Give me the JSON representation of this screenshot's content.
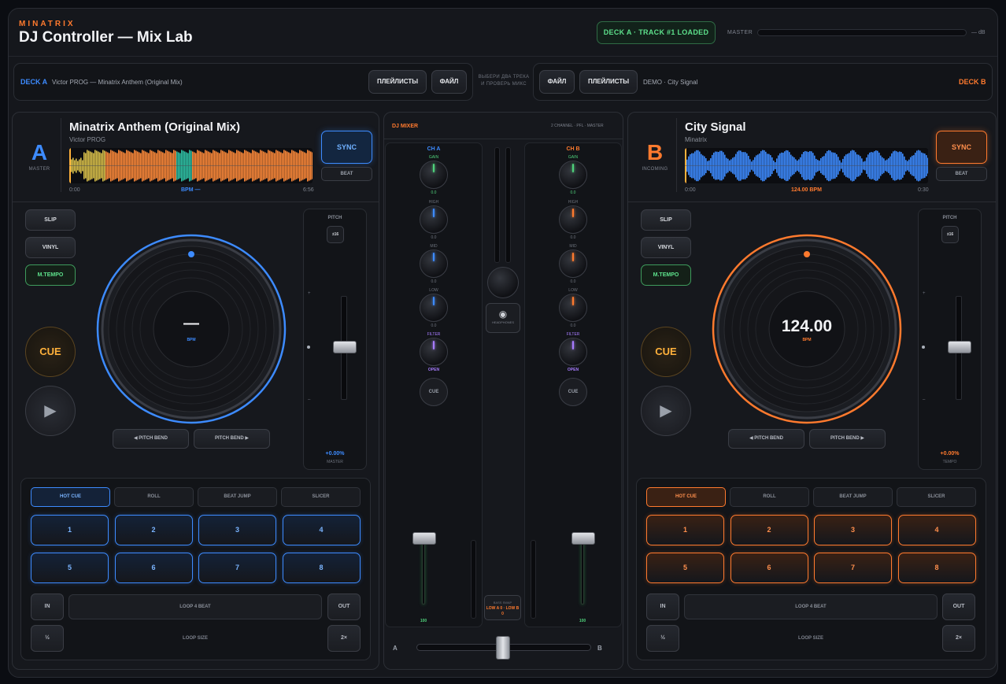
{
  "header": {
    "brand": "MINATRIX",
    "title": "DJ Controller — Mix Lab",
    "status": "DECK A · TRACK #1 LOADED",
    "master_label": "MASTER",
    "master_unit": "— dB",
    "master_level": 0
  },
  "loader": {
    "deck_a": {
      "tag": "DECK A",
      "track": "Victor PROG — Minatrix Anthem (Original Mix)",
      "playlists": "ПЛЕЙЛИСТЫ",
      "file": "ФАЙЛ"
    },
    "hint": "ВЫБЕРИ ДВА ТРЕКА И ПРОВЕРЬ МИКС",
    "deck_b": {
      "tag": "DECK B",
      "track": "DEMO · City Signal",
      "playlists": "ПЛЕЙЛИСТЫ",
      "file": "ФАЙЛ"
    }
  },
  "deck_a": {
    "letter": "A",
    "role": "MASTER",
    "title": "Minatrix Anthem (Original Mix)",
    "artist": "Victor PROG",
    "time_start": "0:00",
    "time_end": "6:56",
    "bpm_label": "BPM —",
    "sync": "SYNC",
    "beat": "BEAT",
    "buttons": {
      "slip": "SLIP",
      "vinyl": "VINYL",
      "mtempo": "M.TEMPO",
      "cue": "CUE",
      "play": "▶"
    },
    "platter": {
      "value": "—",
      "unit": "BPM"
    },
    "pitch": {
      "label": "PITCH",
      "range": "±16",
      "value": "+0.00%",
      "sub": "MASTER",
      "plus": "+",
      "minus": "–"
    },
    "pitch_bend": {
      "left": "◀ PITCH BEND",
      "right": "PITCH BEND ▶"
    },
    "pad_modes": [
      "HOT CUE",
      "ROLL",
      "BEAT JUMP",
      "SLICER"
    ],
    "pads": [
      "1",
      "2",
      "3",
      "4",
      "5",
      "6",
      "7",
      "8"
    ],
    "loop": {
      "in": "IN",
      "out": "OUT",
      "bar": "LOOP 4 BEAT",
      "half": "½",
      "double": "2×",
      "size": "LOOP SIZE"
    }
  },
  "deck_b": {
    "letter": "B",
    "role": "INCOMING",
    "title": "City Signal",
    "artist": "Minatrix",
    "time_start": "0:00",
    "time_end": "0:30",
    "bpm_label": "124.00 BPM",
    "sync": "SYNC",
    "beat": "BEAT",
    "buttons": {
      "slip": "SLIP",
      "vinyl": "VINYL",
      "mtempo": "M.TEMPO",
      "cue": "CUE",
      "play": "▶"
    },
    "platter": {
      "value": "124.00",
      "unit": "BPM"
    },
    "pitch": {
      "label": "PITCH",
      "range": "±16",
      "value": "+0.00%",
      "sub": "TEMPO",
      "plus": "+",
      "minus": "–"
    },
    "pitch_bend": {
      "left": "◀ PITCH BEND",
      "right": "PITCH BEND ▶"
    },
    "pad_modes": [
      "HOT CUE",
      "ROLL",
      "BEAT JUMP",
      "SLICER"
    ],
    "pads": [
      "1",
      "2",
      "3",
      "4",
      "5",
      "6",
      "7",
      "8"
    ],
    "loop": {
      "in": "IN",
      "out": "OUT",
      "bar": "LOOP 4 BEAT",
      "half": "½",
      "double": "2×",
      "size": "LOOP SIZE"
    }
  },
  "mixer": {
    "title": "DJ MIXER",
    "subtitle": "2 CHANNEL · PFL · MASTER",
    "ch_a": {
      "name": "CH A",
      "gain": "GAIN",
      "gain_val": "0.0",
      "high": "HIGH",
      "high_val": "0.0",
      "mid": "MID",
      "mid_val": "0.0",
      "low": "LOW",
      "low_val": "0.0",
      "filter": "FILTER",
      "filter_val": "OPEN",
      "cue": "CUE",
      "fader_val": "100"
    },
    "ch_b": {
      "name": "CH B",
      "gain": "GAIN",
      "gain_val": "0.0",
      "high": "HIGH",
      "high_val": "0.0",
      "mid": "MID",
      "mid_val": "0.0",
      "low": "LOW",
      "low_val": "0.0",
      "filter": "FILTER",
      "filter_val": "OPEN",
      "cue": "CUE",
      "fader_val": "100"
    },
    "headphones": "HEADPHONES",
    "bass_swap_label": "BASS SWAP",
    "bass_swap_value": "LOW A 0 · LOW B 0",
    "xfader_a": "A",
    "xfader_b": "B"
  },
  "colors": {
    "deck_a": "#3d8bff",
    "deck_b": "#ff7a2e",
    "green": "#4fd17b",
    "purple": "#a77bff"
  }
}
